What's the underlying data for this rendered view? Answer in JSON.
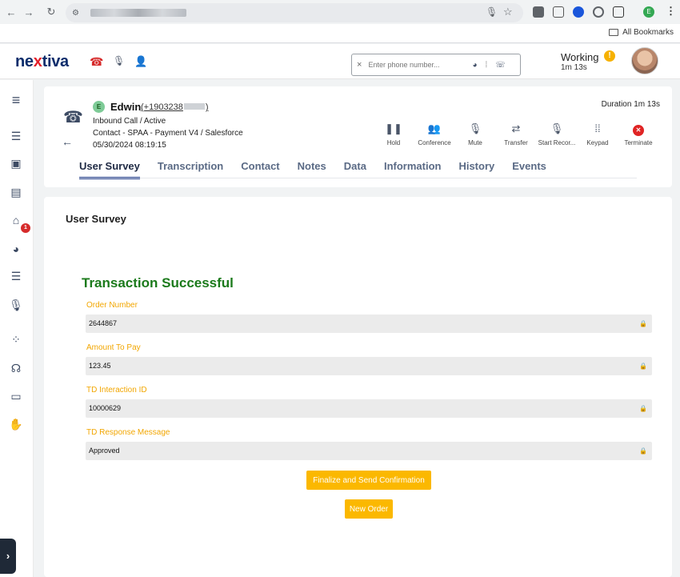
{
  "browser": {
    "back_icon": "arrow-left-icon",
    "bookmarks_label": "All Bookmarks"
  },
  "header": {
    "logo_pre": "ne",
    "logo_x": "x",
    "logo_post": "tiva",
    "phone_placeholder": "Enter phone number...",
    "status_label": "Working",
    "status_time": "1m 13s",
    "status_alert": "!"
  },
  "sidebar": {
    "badge_count": "1"
  },
  "call": {
    "caller_initial": "E",
    "caller_name": "Edwin",
    "caller_number": "(+1903238",
    "caller_number_end": ")",
    "status": "Inbound Call / Active",
    "contact": "Contact - SPAA - Payment V4 / Salesforce",
    "datetime": "05/30/2024 08:19:15",
    "duration": "Duration 1m 13s",
    "actions": [
      {
        "label": "Hold",
        "icon": "pause-icon"
      },
      {
        "label": "Conference",
        "icon": "people-icon"
      },
      {
        "label": "Mute",
        "icon": "microphone-icon"
      },
      {
        "label": "Transfer",
        "icon": "transfer-icon"
      },
      {
        "label": "Start Recor...",
        "icon": "record-mic-icon"
      },
      {
        "label": "Keypad",
        "icon": "keypad-icon"
      },
      {
        "label": "Terminate",
        "icon": "terminate-icon"
      }
    ],
    "tabs": [
      "User Survey",
      "Transcription",
      "Contact",
      "Notes",
      "Data",
      "Information",
      "History",
      "Events"
    ]
  },
  "survey": {
    "title": "User Survey",
    "heading": "Transaction Successful",
    "fields": [
      {
        "label": "Order Number",
        "value": "2644867"
      },
      {
        "label": "Amount To Pay",
        "value": "123.45"
      },
      {
        "label": "TD Interaction ID",
        "value": "10000629"
      },
      {
        "label": "TD Response Message",
        "value": "Approved"
      }
    ],
    "finalize_label": "Finalize and Send Confirmation",
    "new_order_label": "New Order"
  },
  "colors": {
    "accent": "#fbb800",
    "success": "#1b7a1b",
    "brand_navy": "#0a2c6b",
    "brand_red": "#e4202a"
  }
}
